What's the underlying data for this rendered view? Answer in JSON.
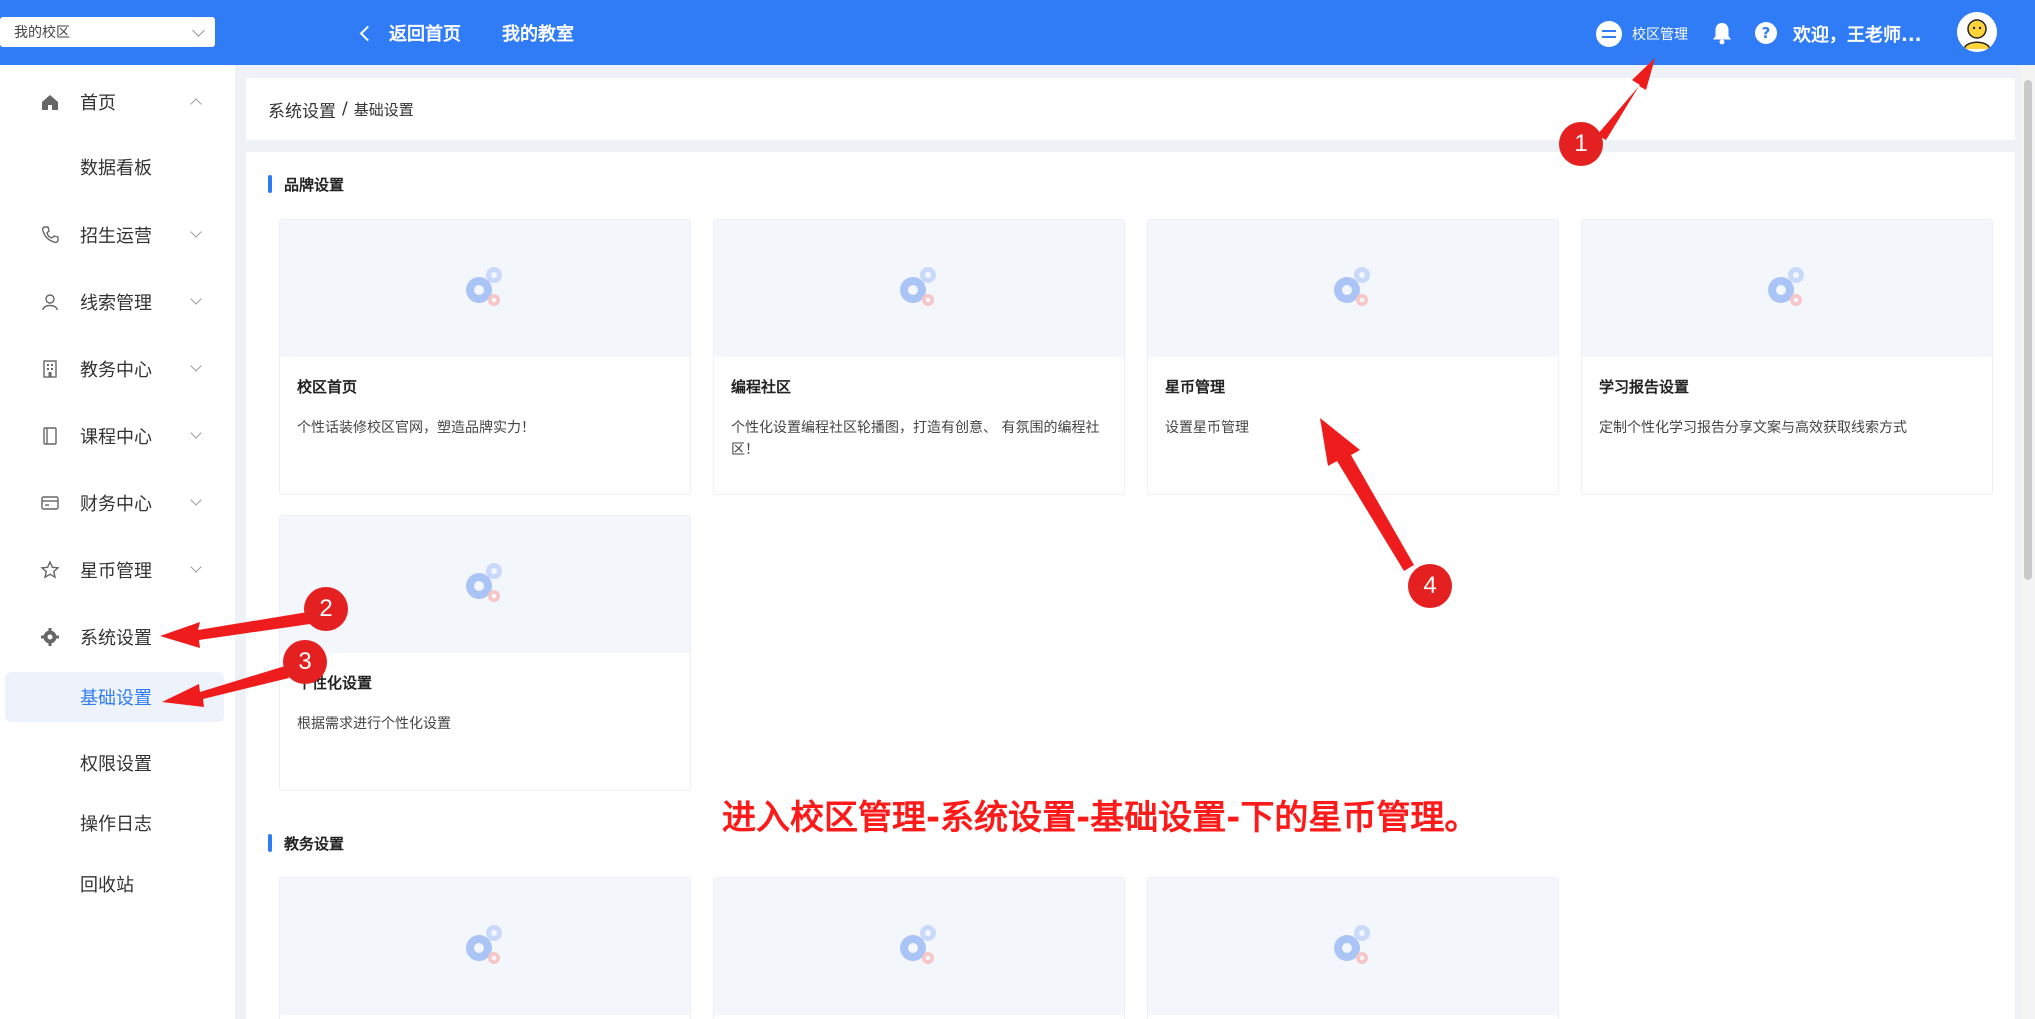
{
  "topbar": {
    "school_select": "我的校区",
    "back_home": "返回首页",
    "my_classroom": "我的教室",
    "campus_mgmt": "校区管理",
    "welcome": "欢迎，王老师..."
  },
  "sidebar": {
    "items": [
      {
        "label": "首页",
        "icon": "home-icon"
      },
      {
        "label": "数据看板"
      },
      {
        "label": "招生运营",
        "icon": "phone-icon"
      },
      {
        "label": "线索管理",
        "icon": "user-icon"
      },
      {
        "label": "教务中心",
        "icon": "building-icon"
      },
      {
        "label": "课程中心",
        "icon": "book-icon"
      },
      {
        "label": "财务中心",
        "icon": "card-icon"
      },
      {
        "label": "星币管理",
        "icon": "star-icon"
      },
      {
        "label": "系统设置",
        "icon": "gear-icon"
      },
      {
        "label": "基础设置"
      },
      {
        "label": "权限设置"
      },
      {
        "label": "操作日志"
      },
      {
        "label": "回收站"
      }
    ]
  },
  "breadcrumb": {
    "parent": "系统设置",
    "sep": "/",
    "current": "基础设置"
  },
  "sections": {
    "brand": {
      "title": "品牌设置",
      "cards": [
        {
          "title": "校区首页",
          "desc": "个性话装修校区官网，塑造品牌实力！"
        },
        {
          "title": "编程社区",
          "desc": "个性化设置编程社区轮播图，打造有创意、 有氛围的编程社区！"
        },
        {
          "title": "星币管理",
          "desc": "设置星币管理"
        },
        {
          "title": "学习报告设置",
          "desc": "定制个性化学习报告分享文案与高效获取线索方式"
        },
        {
          "title": "个性化设置",
          "desc": "根据需求进行个性化设置"
        }
      ]
    },
    "academic": {
      "title": "教务设置"
    }
  },
  "annotation": {
    "text": "进入校区管理-系统设置-基础设置-下的星币管理。",
    "badges": [
      "1",
      "2",
      "3",
      "4"
    ]
  },
  "colors": {
    "primary": "#2f7cf6",
    "annotation_red": "#e52020"
  }
}
